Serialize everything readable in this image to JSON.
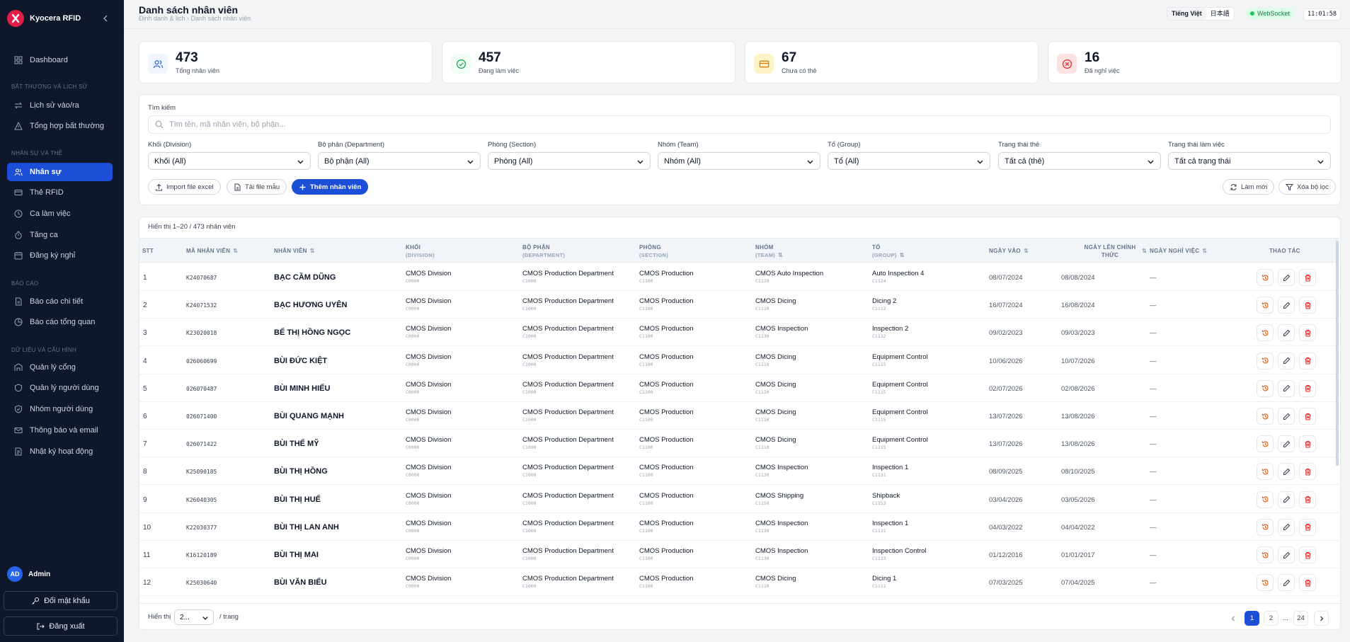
{
  "app": {
    "name": "Kyocera RFID"
  },
  "sidebar": {
    "top": {
      "label": "Dashboard"
    },
    "sections": [
      {
        "title": "Bất thường và lịch sử"
      },
      {
        "title": "Nhân sự và thẻ"
      },
      {
        "title": "Báo cáo"
      },
      {
        "title": "Dữ liệu và cấu hình"
      }
    ],
    "items": [
      {
        "label": "Lịch sử vào/ra",
        "icon": "arrows-icon"
      },
      {
        "label": "Tổng hợp bất thường",
        "icon": "warning-icon"
      },
      {
        "label": "Nhân sự",
        "icon": "users-icon"
      },
      {
        "label": "Thẻ RFID",
        "icon": "card-icon"
      },
      {
        "label": "Ca làm việc",
        "icon": "clock-icon"
      },
      {
        "label": "Tăng ca",
        "icon": "timer-icon"
      },
      {
        "label": "Đăng ký nghỉ",
        "icon": "calendar-icon"
      },
      {
        "label": "Báo cáo chi tiết",
        "icon": "document-icon"
      },
      {
        "label": "Báo cáo tổng quan",
        "icon": "pie-icon"
      },
      {
        "label": "Quản lý cổng",
        "icon": "gate-icon"
      },
      {
        "label": "Quản lý người dùng",
        "icon": "shield-icon"
      },
      {
        "label": "Nhóm người dùng",
        "icon": "group-shield-icon"
      },
      {
        "label": "Thông báo và email",
        "icon": "mail-icon"
      },
      {
        "label": "Nhật ký hoạt động",
        "icon": "log-icon"
      }
    ],
    "user": {
      "initials": "AD",
      "name": "Admin"
    },
    "change_password": "Đổi mật khẩu",
    "logout": "Đăng xuất"
  },
  "header": {
    "title": "Danh sách nhân viên",
    "breadcrumb": "Định danh & lịch › Danh sách nhân viên",
    "lang_vi": "Tiếng Việt",
    "lang_ja": "日本語",
    "ws": "WebSocket",
    "clock": "11:01:58"
  },
  "stats": [
    {
      "value": "473",
      "label": "Tổng nhân viên",
      "color": "#2563eb",
      "bg": "#eff6ff"
    },
    {
      "value": "457",
      "label": "Đang làm việc",
      "color": "#16a34a",
      "bg": "#f0fdf4"
    },
    {
      "value": "67",
      "label": "Chưa có thẻ",
      "color": "#d97706",
      "bg": "#fef3c7"
    },
    {
      "value": "16",
      "label": "Đã nghỉ việc",
      "color": "#dc2626",
      "bg": "#fee2e2"
    }
  ],
  "filters": {
    "search_label": "Tìm kiếm",
    "search_placeholder": "Tìm tên, mã nhân viên, bộ phận...",
    "selects": [
      {
        "label": "Khối (Division)",
        "value": "Khối (All)"
      },
      {
        "label": "Bộ phận (Department)",
        "value": "Bộ phận (All)"
      },
      {
        "label": "Phòng (Section)",
        "value": "Phòng (All)"
      },
      {
        "label": "Nhóm (Team)",
        "value": "Nhóm (All)"
      },
      {
        "label": "Tổ (Group)",
        "value": "Tổ (All)"
      },
      {
        "label": "Trạng thái thẻ",
        "value": "Tất cả (thẻ)"
      },
      {
        "label": "Trạng thái làm việc",
        "value": "Tất cả trạng thái"
      }
    ],
    "import_label": "Import file excel",
    "template_label": "Tải file mẫu",
    "add_label": "Thêm nhân viên",
    "refresh_label": "Làm mới",
    "clear_label": "Xóa bộ lọc"
  },
  "table": {
    "showing": "Hiển thị 1–20 / 473 nhân viên",
    "headers": {
      "stt": "STT",
      "code": "Mã nhân viên",
      "name": "Nhân viên",
      "division": "Khối",
      "division_sub": "(Division)",
      "department": "Bộ phận",
      "department_sub": "(Department)",
      "section": "Phòng",
      "section_sub": "(Section)",
      "team": "Nhóm",
      "team_sub": "(Team)",
      "group": "Tổ",
      "group_sub": "(Group)",
      "start": "Ngày vào",
      "official": "Ngày lên chính",
      "official2": "thức",
      "quit": "Ngày nghỉ việc",
      "actions": "Thao tác"
    },
    "rows": [
      {
        "stt": "1",
        "code": "K24070687",
        "name": "BẠC CẦM DŨNG",
        "div": "CMOS Division",
        "div_code": "C0000",
        "dept": "CMOS Production Department",
        "dept_code": "C1000",
        "sec": "CMOS Production",
        "sec_code": "C1100",
        "team": "CMOS Auto Inspection",
        "team_code": "C1120",
        "group": "Auto Inspection 4",
        "group_code": "C1124",
        "start": "08/07/2024",
        "official": "08/08/2024",
        "quit": "—"
      },
      {
        "stt": "2",
        "code": "K24071532",
        "name": "BẠC HƯƠNG UYÊN",
        "div": "CMOS Division",
        "div_code": "C0000",
        "dept": "CMOS Production Department",
        "dept_code": "C1000",
        "sec": "CMOS Production",
        "sec_code": "C1100",
        "team": "CMOS Dicing",
        "team_code": "C1110",
        "group": "Dicing 2",
        "group_code": "C1112",
        "start": "16/07/2024",
        "official": "16/08/2024",
        "quit": "—"
      },
      {
        "stt": "3",
        "code": "K23020018",
        "name": "BẾ THỊ HỒNG NGỌC",
        "div": "CMOS Division",
        "div_code": "C0000",
        "dept": "CMOS Production Department",
        "dept_code": "C1000",
        "sec": "CMOS Production",
        "sec_code": "C1100",
        "team": "CMOS Inspection",
        "team_code": "C1130",
        "group": "Inspection 2",
        "group_code": "C1132",
        "start": "09/02/2023",
        "official": "09/03/2023",
        "quit": "—"
      },
      {
        "stt": "4",
        "code": "026060699",
        "name": "BÙI ĐỨC KIỆT",
        "div": "CMOS Division",
        "div_code": "C0000",
        "dept": "CMOS Production Department",
        "dept_code": "C1000",
        "sec": "CMOS Production",
        "sec_code": "C1100",
        "team": "CMOS Dicing",
        "team_code": "C1110",
        "group": "Equipment Control",
        "group_code": "C1115",
        "start": "10/06/2026",
        "official": "10/07/2026",
        "quit": "—"
      },
      {
        "stt": "5",
        "code": "026070487",
        "name": "BÙI MINH HIẾU",
        "div": "CMOS Division",
        "div_code": "C0000",
        "dept": "CMOS Production Department",
        "dept_code": "C1000",
        "sec": "CMOS Production",
        "sec_code": "C1100",
        "team": "CMOS Dicing",
        "team_code": "C1110",
        "group": "Equipment Control",
        "group_code": "C1115",
        "start": "02/07/2026",
        "official": "02/08/2026",
        "quit": "—"
      },
      {
        "stt": "6",
        "code": "026071400",
        "name": "BÙI QUANG MẠNH",
        "div": "CMOS Division",
        "div_code": "C0000",
        "dept": "CMOS Production Department",
        "dept_code": "C1000",
        "sec": "CMOS Production",
        "sec_code": "C1100",
        "team": "CMOS Dicing",
        "team_code": "C1110",
        "group": "Equipment Control",
        "group_code": "C1115",
        "start": "13/07/2026",
        "official": "13/08/2026",
        "quit": "—"
      },
      {
        "stt": "7",
        "code": "026071422",
        "name": "BÙI THẾ MỸ",
        "div": "CMOS Division",
        "div_code": "C0000",
        "dept": "CMOS Production Department",
        "dept_code": "C1000",
        "sec": "CMOS Production",
        "sec_code": "C1100",
        "team": "CMOS Dicing",
        "team_code": "C1110",
        "group": "Equipment Control",
        "group_code": "C1115",
        "start": "13/07/2026",
        "official": "13/08/2026",
        "quit": "—"
      },
      {
        "stt": "8",
        "code": "K25090185",
        "name": "BÙI THỊ HỒNG",
        "div": "CMOS Division",
        "div_code": "C0000",
        "dept": "CMOS Production Department",
        "dept_code": "C1000",
        "sec": "CMOS Production",
        "sec_code": "C1100",
        "team": "CMOS Inspection",
        "team_code": "C1130",
        "group": "Inspection 1",
        "group_code": "C1131",
        "start": "08/09/2025",
        "official": "08/10/2025",
        "quit": "—"
      },
      {
        "stt": "9",
        "code": "K26040305",
        "name": "BÙI THỊ HUẾ",
        "div": "CMOS Division",
        "div_code": "C0000",
        "dept": "CMOS Production Department",
        "dept_code": "C1000",
        "sec": "CMOS Production",
        "sec_code": "C1100",
        "team": "CMOS Shipping",
        "team_code": "C1150",
        "group": "Shipback",
        "group_code": "C1153",
        "start": "03/04/2026",
        "official": "03/05/2026",
        "quit": "—"
      },
      {
        "stt": "10",
        "code": "K22030377",
        "name": "BÙI THỊ LAN ANH",
        "div": "CMOS Division",
        "div_code": "C0000",
        "dept": "CMOS Production Department",
        "dept_code": "C1000",
        "sec": "CMOS Production",
        "sec_code": "C1100",
        "team": "CMOS Inspection",
        "team_code": "C1130",
        "group": "Inspection 1",
        "group_code": "C1131",
        "start": "04/03/2022",
        "official": "04/04/2022",
        "quit": "—"
      },
      {
        "stt": "11",
        "code": "K16120189",
        "name": "BÙI THỊ MAI",
        "div": "CMOS Division",
        "div_code": "C0000",
        "dept": "CMOS Production Department",
        "dept_code": "C1000",
        "sec": "CMOS Production",
        "sec_code": "C1100",
        "team": "CMOS Inspection",
        "team_code": "C1130",
        "group": "Inspection Control",
        "group_code": "C1133",
        "start": "01/12/2016",
        "official": "01/01/2017",
        "quit": "—"
      },
      {
        "stt": "12",
        "code": "K25030640",
        "name": "BÙI VĂN BIẾU",
        "div": "CMOS Division",
        "div_code": "C0000",
        "dept": "CMOS Production Department",
        "dept_code": "C1000",
        "sec": "CMOS Production",
        "sec_code": "C1100",
        "team": "CMOS Dicing",
        "team_code": "C1110",
        "group": "Dicing 1",
        "group_code": "C1111",
        "start": "07/03/2025",
        "official": "07/04/2025",
        "quit": "—"
      }
    ]
  },
  "footer": {
    "show_label": "Hiển thị",
    "page_size": "2...",
    "per_page": "/ trang",
    "pages": [
      "1",
      "2",
      "...",
      "24"
    ],
    "current": "1"
  }
}
